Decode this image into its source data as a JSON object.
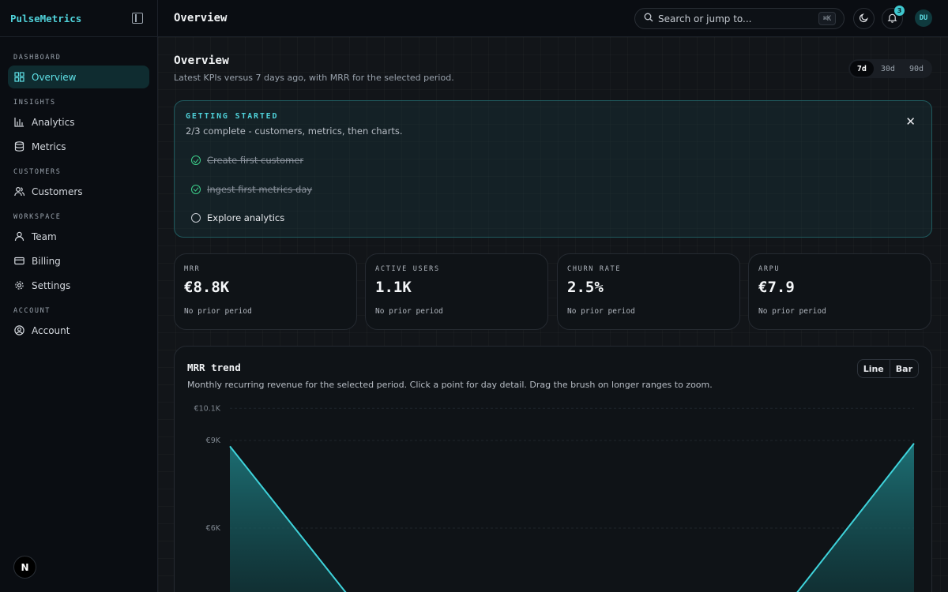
{
  "brand": "PulseMetrics",
  "sidebar": {
    "sections": [
      {
        "title": "DASHBOARD",
        "items": [
          {
            "label": "Overview",
            "icon": "grid-icon",
            "active": true
          }
        ]
      },
      {
        "title": "INSIGHTS",
        "items": [
          {
            "label": "Analytics",
            "icon": "bar-chart-icon"
          },
          {
            "label": "Metrics",
            "icon": "database-icon"
          }
        ]
      },
      {
        "title": "CUSTOMERS",
        "items": [
          {
            "label": "Customers",
            "icon": "users-icon"
          }
        ]
      },
      {
        "title": "WORKSPACE",
        "items": [
          {
            "label": "Team",
            "icon": "user-icon"
          },
          {
            "label": "Billing",
            "icon": "credit-card-icon"
          },
          {
            "label": "Settings",
            "icon": "gear-icon"
          }
        ]
      },
      {
        "title": "ACCOUNT",
        "items": [
          {
            "label": "Account",
            "icon": "user-circle-icon"
          }
        ]
      }
    ],
    "footer_badge": "N"
  },
  "topbar": {
    "title": "Overview",
    "search_placeholder": "Search or jump to...",
    "search_shortcut": "⌘K",
    "notification_count": "3",
    "avatar_initials": "DU"
  },
  "page": {
    "title": "Overview",
    "subtitle": "Latest KPIs versus 7 days ago, with MRR for the selected period.",
    "periods": [
      {
        "label": "7d",
        "active": true
      },
      {
        "label": "30d"
      },
      {
        "label": "90d"
      }
    ]
  },
  "getting_started": {
    "title": "GETTING STARTED",
    "subtitle": "2/3 complete - customers, metrics, then charts.",
    "items": [
      {
        "label": "Create first customer",
        "done": true
      },
      {
        "label": "Ingest first metrics day",
        "done": true
      },
      {
        "label": "Explore analytics",
        "done": false
      }
    ]
  },
  "kpis": [
    {
      "label": "MRR",
      "value": "€8.8K",
      "note": "No prior period"
    },
    {
      "label": "ACTIVE USERS",
      "value": "1.1K",
      "note": "No prior period"
    },
    {
      "label": "CHURN RATE",
      "value": "2.5%",
      "note": "No prior period"
    },
    {
      "label": "ARPU",
      "value": "€7.9",
      "note": "No prior period"
    }
  ],
  "chart": {
    "title": "MRR trend",
    "subtitle": "Monthly recurring revenue for the selected period. Click a point for day detail. Drag the brush on longer ranges to zoom.",
    "toggle": [
      "Line",
      "Bar"
    ],
    "accent": "#3fd3db"
  },
  "chart_data": {
    "type": "area",
    "title": "MRR trend",
    "y_ticks": [
      "€10.1K",
      "€9K",
      "€6K"
    ],
    "y_tick_values": [
      10100,
      9000,
      6000
    ],
    "series": [
      {
        "values": [
          8800,
          3000,
          3000,
          8900
        ]
      }
    ]
  }
}
